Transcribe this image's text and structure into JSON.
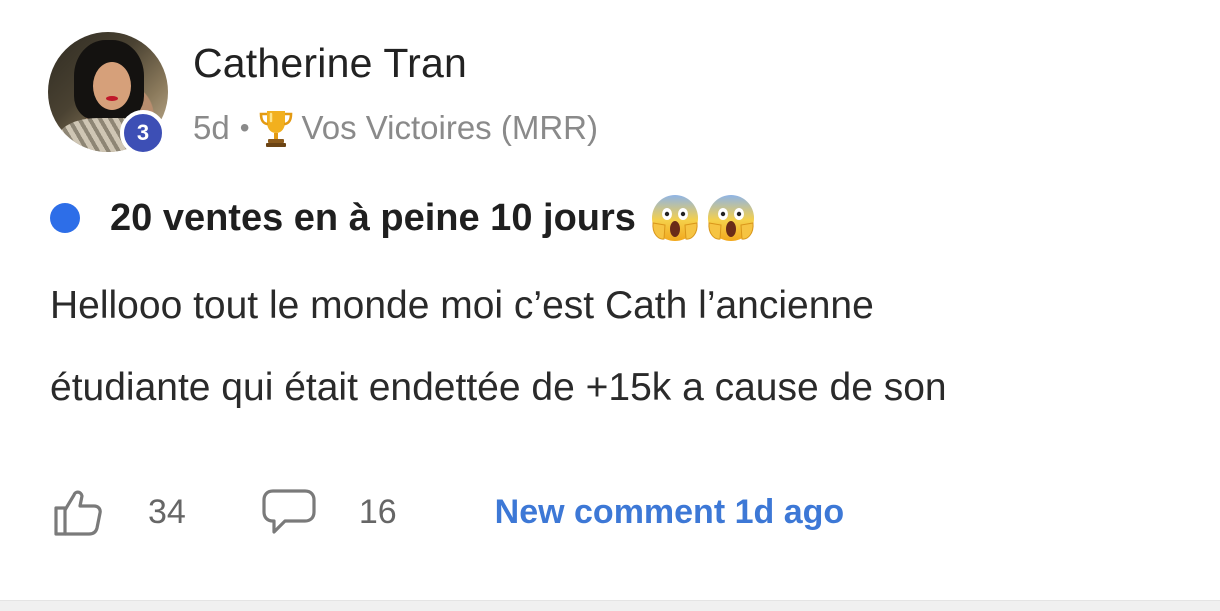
{
  "author": {
    "name": "Catherine Tran",
    "level": "3"
  },
  "meta": {
    "time": "5d",
    "separator": "•",
    "category_icon": "trophy-icon",
    "category": "Vos Victoires (MRR)"
  },
  "post": {
    "title": "20 ventes en à peine 10 jours",
    "title_emojis": [
      "face-screaming-in-fear-icon",
      "face-screaming-in-fear-icon"
    ],
    "unread_color": "#2d6ee8",
    "body_lines": [
      "Hellooo tout le monde moi c’est Cath l’ancienne",
      "étudiante qui était endettée de +15k a cause de son"
    ]
  },
  "actions": {
    "like_icon": "thumbs-up-icon",
    "likes": "34",
    "comment_icon": "comment-bubble-icon",
    "comments": "16",
    "new_comment": "New comment 1d ago"
  },
  "colors": {
    "accent_blue": "#3d78d6",
    "level_badge": "#3d4fb5",
    "meta_gray": "#8a8a8a"
  }
}
